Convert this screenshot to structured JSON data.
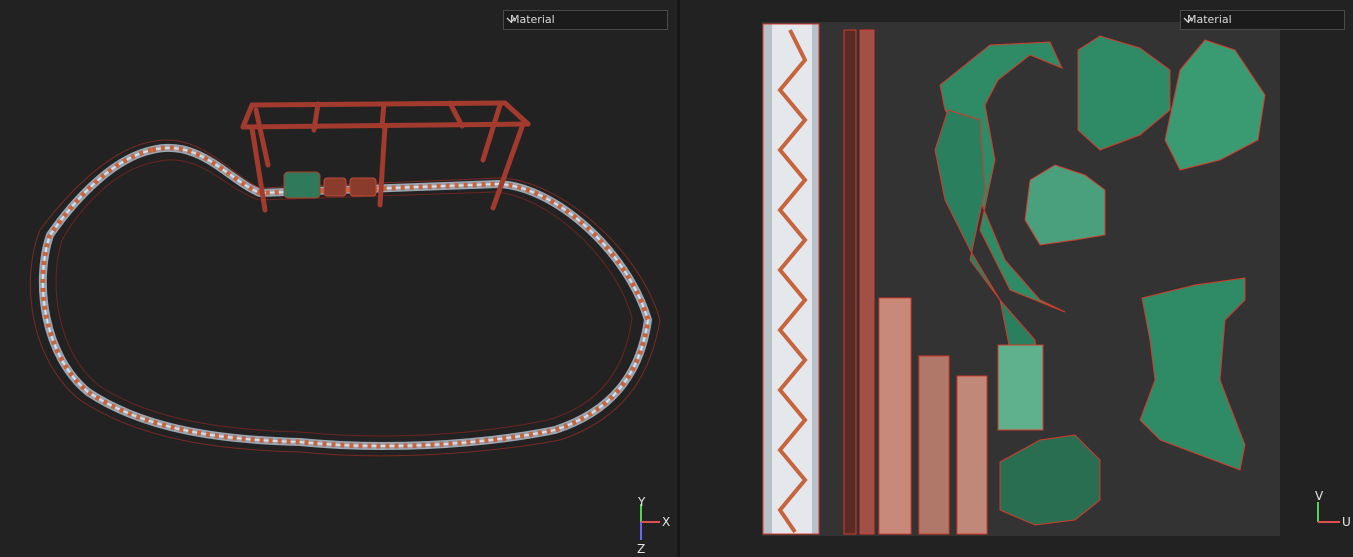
{
  "viewport_3d": {
    "material_dropdown": {
      "value": "Material"
    },
    "axes": {
      "up": "Y",
      "right": "X",
      "depth": "Z"
    }
  },
  "uv_editor": {
    "material_dropdown": {
      "value": "Material"
    },
    "axes": {
      "up": "V",
      "right": "U"
    }
  },
  "colors": {
    "panel_bg": "#222222",
    "uv_canvas": "#333333",
    "track_steel": "#8a96a3",
    "truss_orange": "#c8643c",
    "frame_red": "#a23a2e",
    "island_green": "#2f8a66",
    "wire_red": "#d43a2a"
  }
}
